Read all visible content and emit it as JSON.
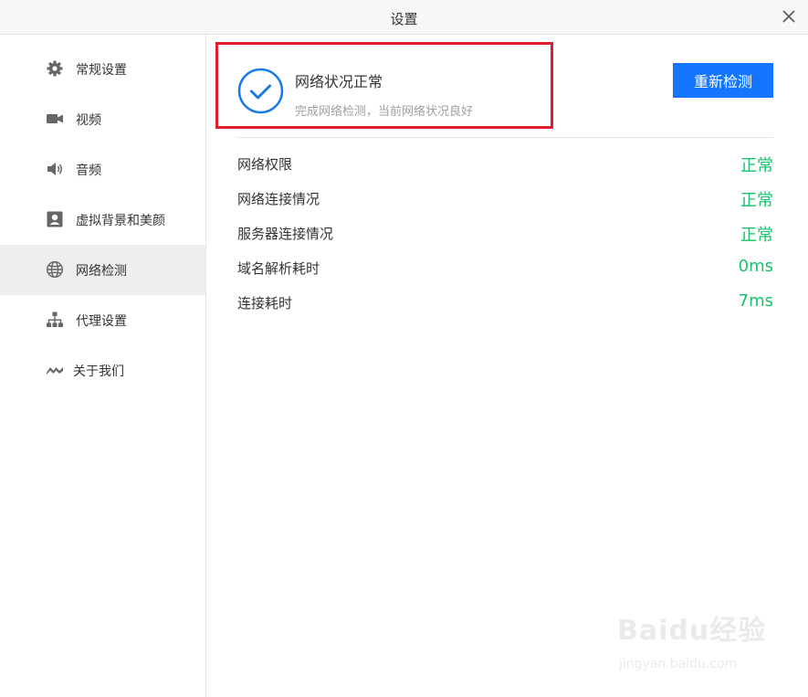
{
  "window": {
    "title": "设置"
  },
  "sidebar": {
    "items": [
      {
        "label": "常规设置",
        "icon": "gear-icon",
        "active": false
      },
      {
        "label": "视频",
        "icon": "video-camera-icon",
        "active": false
      },
      {
        "label": "音频",
        "icon": "speaker-icon",
        "active": false
      },
      {
        "label": "虚拟背景和美颜",
        "icon": "portrait-icon",
        "active": false
      },
      {
        "label": "网络检测",
        "icon": "globe-icon",
        "active": true
      },
      {
        "label": "代理设置",
        "icon": "network-tree-icon",
        "active": false
      },
      {
        "label": "关于我们",
        "icon": "logo-icon",
        "active": false
      }
    ]
  },
  "main": {
    "status": {
      "title": "网络状况正常",
      "subtitle": "完成网络检测，当前网络状况良好"
    },
    "recheck_label": "重新检测",
    "results": [
      {
        "label": "网络权限",
        "value": "正常"
      },
      {
        "label": "网络连接情况",
        "value": "正常"
      },
      {
        "label": "服务器连接情况",
        "value": "正常"
      },
      {
        "label": "域名解析耗时",
        "value": "0ms"
      },
      {
        "label": "连接耗时",
        "value": "7ms"
      }
    ]
  },
  "watermark": {
    "logo": "Baidu经验",
    "url": "jingyan.baidu.com"
  },
  "colors": {
    "accent": "#1476ff",
    "ok_green": "#16c26a",
    "highlight_red": "#e01e2b",
    "check_blue": "#1a7be6"
  }
}
